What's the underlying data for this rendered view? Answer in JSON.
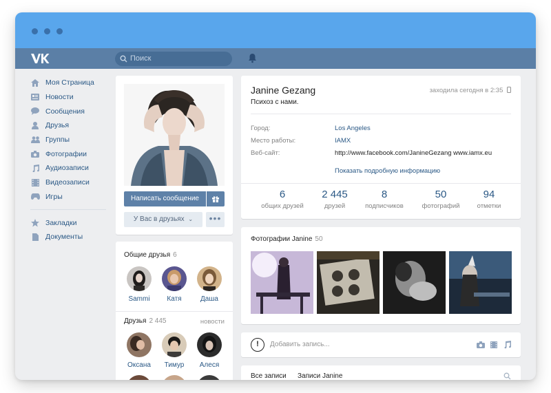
{
  "window": {
    "buttons": [
      "close",
      "minimize",
      "zoom"
    ]
  },
  "topbar": {
    "logo_icon": "vk-logo",
    "search_placeholder": "Поиск",
    "notifications_icon": "bell-icon"
  },
  "menu": {
    "items": [
      {
        "label": "Моя Страница",
        "icon": "home-icon"
      },
      {
        "label": "Новости",
        "icon": "news-icon"
      },
      {
        "label": "Сообщения",
        "icon": "messages-icon"
      },
      {
        "label": "Друзья",
        "icon": "friends-icon"
      },
      {
        "label": "Группы",
        "icon": "groups-icon"
      },
      {
        "label": "Фотографии",
        "icon": "camera-icon"
      },
      {
        "label": "Аудиозаписи",
        "icon": "music-icon"
      },
      {
        "label": "Видеозаписи",
        "icon": "video-icon"
      },
      {
        "label": "Игры",
        "icon": "gamepad-icon"
      }
    ],
    "extra": [
      {
        "label": "Закладки",
        "icon": "star-icon"
      },
      {
        "label": "Документы",
        "icon": "document-icon"
      }
    ]
  },
  "profile_actions": {
    "message_button": "Написать сообщение",
    "gift_icon": "gift-icon",
    "friends_button": "У Вас в друзьях",
    "more_button": "•••"
  },
  "common_friends": {
    "title": "Общие друзья",
    "count": "6",
    "people": [
      "Sammi",
      "Катя",
      "Даша"
    ]
  },
  "friends": {
    "title": "Друзья",
    "count": "2 445",
    "link": "новости",
    "people": [
      "Оксана",
      "Тимур",
      "Алеся"
    ]
  },
  "profile": {
    "name": "Janine Gezang",
    "status": "Психоз с нами.",
    "last_seen": "заходила сегодня в 2:35",
    "fields": [
      {
        "label": "Город:",
        "value": "Los Angeles"
      },
      {
        "label": "Место работы:",
        "value": "IAMX"
      },
      {
        "label": "Веб-сайт:",
        "value": "http://www.facebook.com/JanineGezang www.iamx.eu"
      }
    ],
    "more_info": "Показать подробную информацию",
    "stats": [
      {
        "value": "6",
        "label": "общих друзей"
      },
      {
        "value": "2 445",
        "label": "друзей"
      },
      {
        "value": "8",
        "label": "подписчиков"
      },
      {
        "value": "50",
        "label": "фотографий"
      },
      {
        "value": "94",
        "label": "отметки"
      }
    ]
  },
  "photos": {
    "title": "Фотографии Janine",
    "count": "50"
  },
  "post": {
    "placeholder": "Добавить запись..."
  },
  "wall": {
    "tab_all": "Все записи",
    "tab_own": "Записи Janine"
  }
}
